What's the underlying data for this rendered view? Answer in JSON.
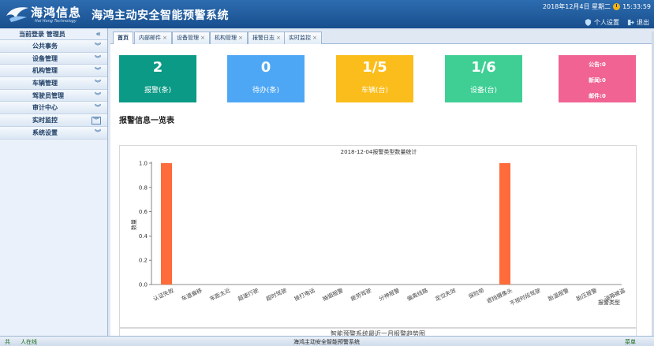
{
  "header": {
    "logo_cn": "海鸿信息",
    "logo_en": "Hai Hong Technology",
    "title": "海鸿主动安全智能预警系统",
    "datetime": "2018年12月4日 星期二",
    "clock_time": "15:33:59",
    "personal_settings": "个人设置",
    "logout": "退出"
  },
  "sidebar": {
    "current_user": "当前登录 管理员",
    "items": [
      {
        "label": "公共事务"
      },
      {
        "label": "设备管理"
      },
      {
        "label": "机构管理"
      },
      {
        "label": "车辆管理"
      },
      {
        "label": "驾驶员管理"
      },
      {
        "label": "审计中心"
      },
      {
        "label": "实时监控"
      },
      {
        "label": "系统设置"
      }
    ]
  },
  "tabs": [
    {
      "label": "首页"
    },
    {
      "label": "内部邮件"
    },
    {
      "label": "设备管理"
    },
    {
      "label": "机构管理"
    },
    {
      "label": "报警日志"
    },
    {
      "label": "实时监控"
    }
  ],
  "cards": [
    {
      "value": "2",
      "label": "报警(条)",
      "color": "#0b9a86"
    },
    {
      "value": "0",
      "label": "待办(条)",
      "color": "#4ea7f5"
    },
    {
      "value": "1/5",
      "label": "车辆(台)",
      "color": "#fbbd1b"
    },
    {
      "value": "1/6",
      "label": "设备(台)",
      "color": "#3fcf95"
    }
  ],
  "notices": {
    "announcement": "公告:0",
    "news": "新闻:0",
    "mail": "邮件:0",
    "color": "#f06393"
  },
  "section_title": "报警信息一览表",
  "chart_data": {
    "type": "bar",
    "title": "2018-12-04报警类型数量统计",
    "ylabel": "数量",
    "xlabel": "报警类型",
    "ylim": [
      0,
      1.0
    ],
    "yticks": [
      "0.0",
      "0.2",
      "0.4",
      "0.6",
      "0.8",
      "1.0"
    ],
    "categories": [
      "认证失败",
      "车道偏移",
      "车距太近",
      "超速行驶",
      "超时驾驶",
      "接打电话",
      "抽烟报警",
      "疲劳驾驶",
      "分神报警",
      "偏离线路",
      "定位失效",
      "保险带",
      "遮挡摄像头",
      "不按时段驾驶",
      "胎温报警",
      "胎压报警",
      "油箱被盗"
    ],
    "values": [
      1,
      0,
      0,
      0,
      0,
      0,
      0,
      0,
      0,
      0,
      0,
      0,
      1,
      0,
      0,
      0,
      0
    ],
    "bar_color": "#ff6b3a",
    "grid": false
  },
  "next_panel_title": "智能预警系统最近一月报警趋势图",
  "footer": {
    "left_1": "共",
    "left_2": "人在线",
    "center": "海鸿主动安全智能预警系统",
    "right": "菜单"
  }
}
